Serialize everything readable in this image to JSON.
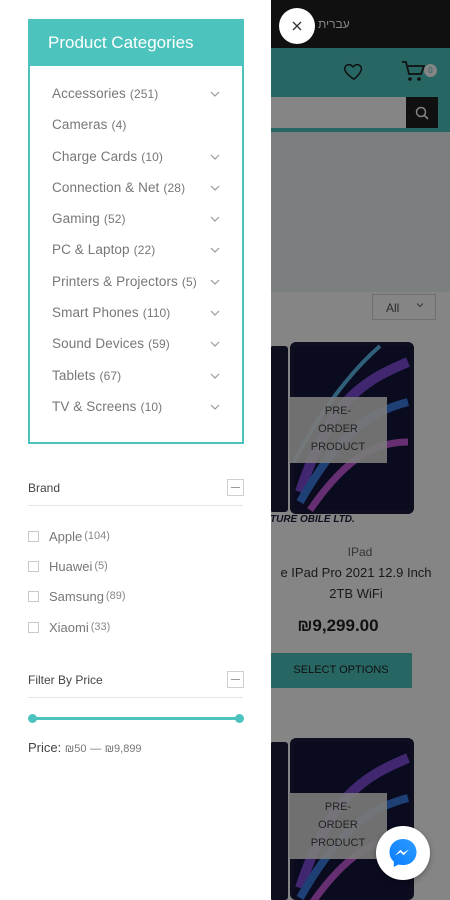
{
  "background": {
    "lang_label": "עברית",
    "cart_count": "0",
    "filter_select": "All",
    "preorder_label_lines": [
      "PRE-",
      "ORDER",
      "PRODUCT"
    ],
    "brand_logo_text": "TURE OBILE LTD.",
    "product": {
      "category": "IPad",
      "title_line1": "e IPad Pro 2021 12.9 Inch",
      "title_line2": "2TB WiFi",
      "price": "₪9,299.00",
      "button_label": "SELECT OPTIONS"
    },
    "colors": {
      "accent": "#4cc3bd",
      "dark": "#1f1f1f"
    }
  },
  "drawer": {
    "close_icon": "close-icon",
    "categories": {
      "title": "Product Categories",
      "items": [
        {
          "label": "Accessories",
          "count": "(251)",
          "has_children": true
        },
        {
          "label": "Cameras",
          "count": "(4)",
          "has_children": false
        },
        {
          "label": "Charge Cards",
          "count": "(10)",
          "has_children": true
        },
        {
          "label": "Connection & Net",
          "count": "(28)",
          "has_children": true
        },
        {
          "label": "Gaming",
          "count": "(52)",
          "has_children": true
        },
        {
          "label": "PC & Laptop",
          "count": "(22)",
          "has_children": true
        },
        {
          "label": "Printers & Projectors",
          "count": "(5)",
          "has_children": true
        },
        {
          "label": "Smart Phones",
          "count": "(110)",
          "has_children": true
        },
        {
          "label": "Sound Devices",
          "count": "(59)",
          "has_children": true
        },
        {
          "label": "Tablets",
          "count": "(67)",
          "has_children": true
        },
        {
          "label": "TV & Screens",
          "count": "(10)",
          "has_children": true
        }
      ]
    },
    "brand": {
      "title": "Brand",
      "items": [
        {
          "label": "Apple",
          "count": "(104)"
        },
        {
          "label": "Huawei",
          "count": "(5)"
        },
        {
          "label": "Samsung",
          "count": "(89)"
        },
        {
          "label": "Xiaomi",
          "count": "(33)"
        }
      ]
    },
    "price_filter": {
      "title": "Filter By Price",
      "label": "Price:",
      "min": "₪50",
      "separator": "—",
      "max": "₪9,899"
    }
  }
}
